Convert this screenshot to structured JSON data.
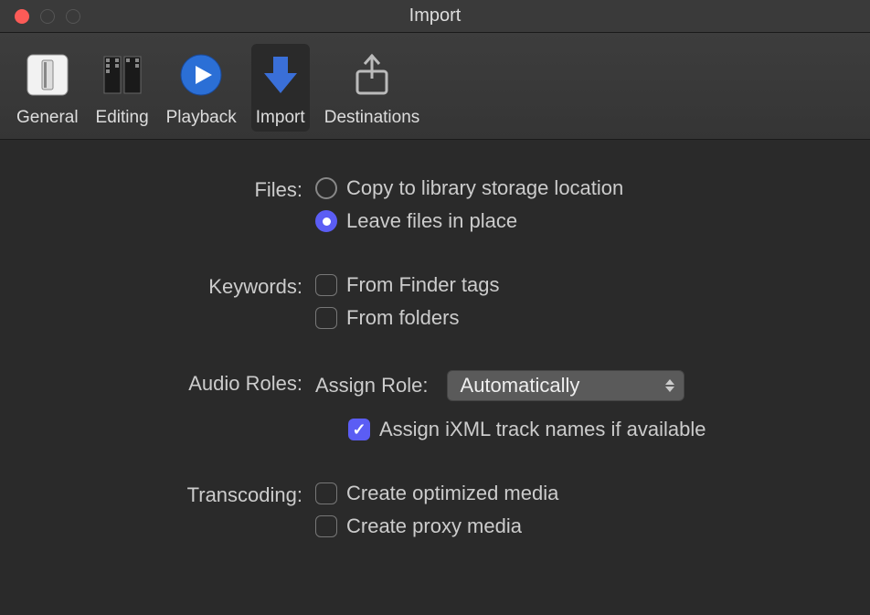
{
  "window": {
    "title": "Import"
  },
  "toolbar": {
    "items": [
      {
        "label": "General"
      },
      {
        "label": "Editing"
      },
      {
        "label": "Playback"
      },
      {
        "label": "Import"
      },
      {
        "label": "Destinations"
      }
    ]
  },
  "sections": {
    "files": {
      "label": "Files:",
      "opt_copy": "Copy to library storage location",
      "opt_leave": "Leave files in place"
    },
    "keywords": {
      "label": "Keywords:",
      "finder": "From Finder tags",
      "folders": "From folders"
    },
    "audio": {
      "label": "Audio Roles:",
      "assign_label": "Assign Role:",
      "assign_value": "Automatically",
      "ixml": "Assign iXML track names if available"
    },
    "transcoding": {
      "label": "Transcoding:",
      "optimized": "Create optimized media",
      "proxy": "Create proxy media"
    }
  }
}
